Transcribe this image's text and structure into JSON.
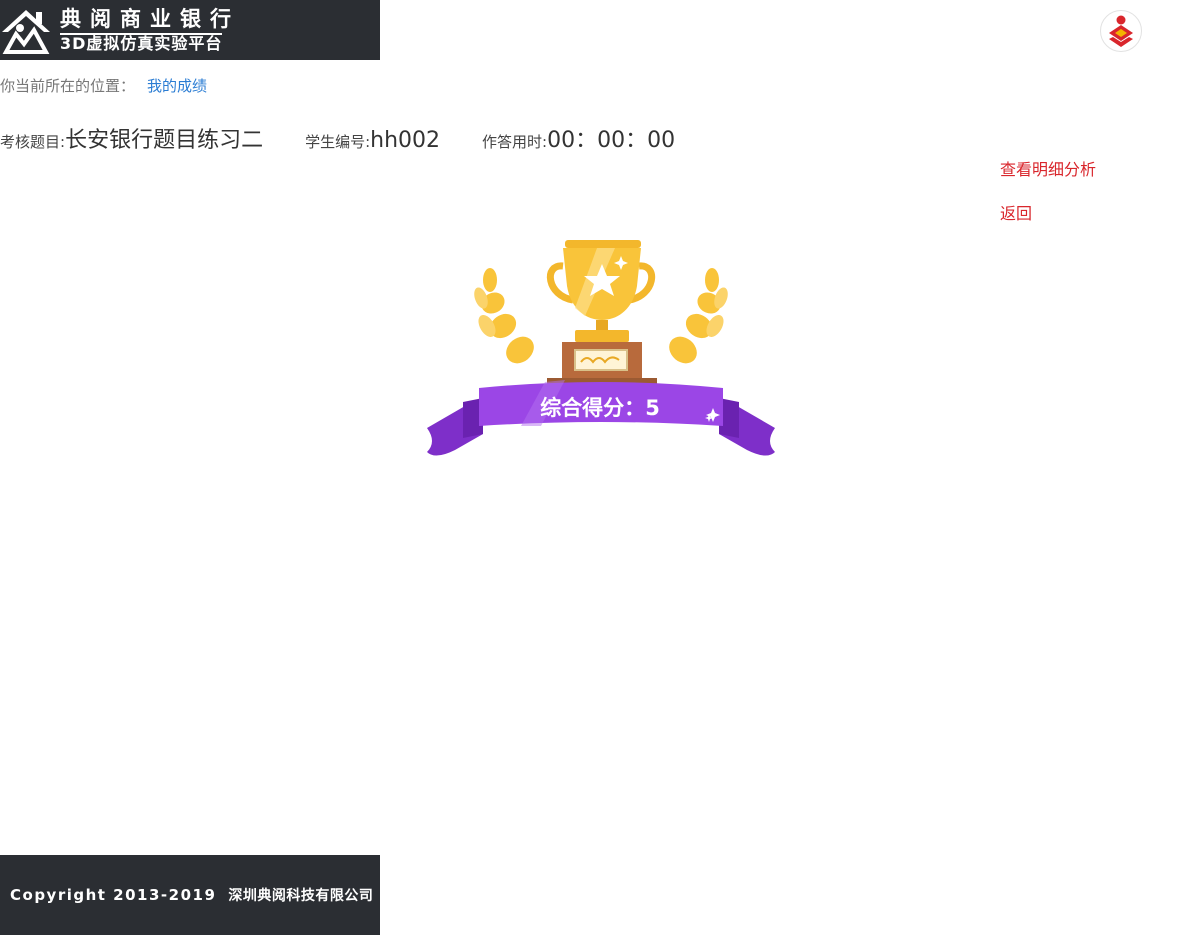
{
  "header": {
    "logo_title": "典阅商业银行",
    "logo_subtitle": "3D虚拟仿真实验平台"
  },
  "breadcrumb": {
    "prefix": "你当前所在的位置：",
    "current": "我的成绩"
  },
  "exam_info": {
    "subject_label": "考核题目:",
    "subject_value": "长安银行题目练习二",
    "student_label": "学生编号:",
    "student_value": "hh002",
    "time_label": "作答用时:",
    "time_value": "00：00：00"
  },
  "actions": {
    "detail_link": "查看明细分析",
    "back_link": "返回"
  },
  "result": {
    "score_label": "综合得分：",
    "score_value": "5"
  },
  "footer": {
    "copyright": "Copyright  2013-2019",
    "company": "深圳典阅科技有限公司"
  },
  "colors": {
    "header_bg": "#2b2e33",
    "link_blue": "#2a7cd3",
    "link_red": "#d9262c",
    "ribbon_purple": "#9b46e6",
    "trophy_gold": "#f9c43a"
  },
  "icons": {
    "logo": "house-logo-icon",
    "avatar": "user-avatar-icon",
    "trophy": "trophy-icon"
  }
}
